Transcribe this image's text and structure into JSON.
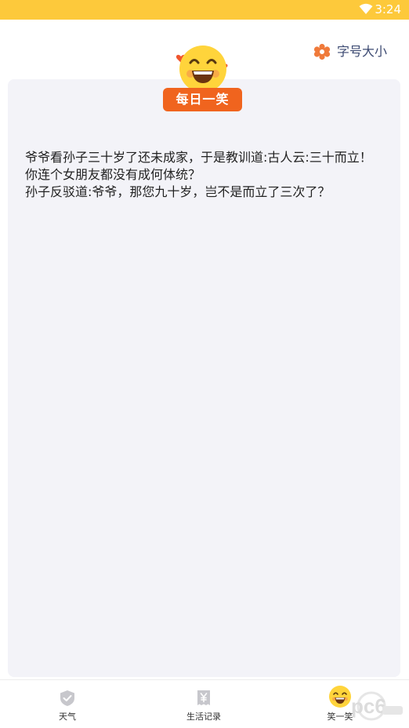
{
  "status_bar": {
    "time": "3:24",
    "wifi_icon": "wifi-icon"
  },
  "header": {
    "font_size_label": "字号大小",
    "font_size_icon": "gear-icon"
  },
  "badge": {
    "label": "每日一笑"
  },
  "joke": {
    "text": "爷爷看孙子三十岁了还未成家，于是教训道:古人云:三十而立！你连个女朋友都没有成何体统？\n孙子反驳道:爷爷，那您九十岁，岂不是而立了三次了？"
  },
  "bottom_nav": [
    {
      "label": "天气",
      "icon": "shield-check-icon"
    },
    {
      "label": "生活记录",
      "icon": "yen-receipt-icon"
    },
    {
      "label": "笑一笑",
      "icon": "laughing-face-icon",
      "active": true
    }
  ],
  "watermark": {
    "text": "pc6"
  },
  "colors": {
    "status_bar": "#FDC93B",
    "badge": "#F0641E",
    "card": "#F3F3F8",
    "accent_text": "#3C4A72",
    "gear": "#F07A3A"
  }
}
